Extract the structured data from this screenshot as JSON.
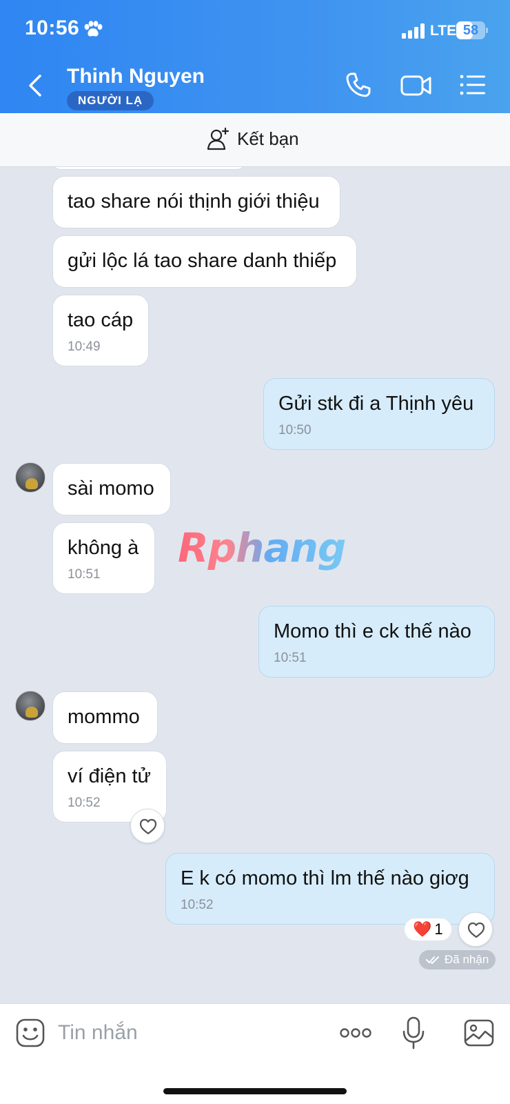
{
  "status_bar": {
    "time": "10:56",
    "network": "LTE",
    "battery": "58",
    "battery_fraction": 0.58
  },
  "header": {
    "contact_name": "Thinh Nguyen",
    "badge": "NGƯỜI LẠ",
    "icons": [
      "back-arrow-icon",
      "phone-icon",
      "video-call-icon",
      "menu-list-icon"
    ]
  },
  "add_friend": {
    "label": "Kết bạn"
  },
  "messages": [
    {
      "side": "in",
      "text": "tao share nói thịnh giới thiệu"
    },
    {
      "side": "in",
      "text": "gửi lộc lá tao share danh thiếp"
    },
    {
      "side": "in",
      "text": "tao cáp",
      "time": "10:49"
    },
    {
      "side": "out",
      "text": "Gửi stk đi a Thịnh yêu",
      "time": "10:50"
    },
    {
      "side": "in",
      "text": "sài momo"
    },
    {
      "side": "in",
      "text": "không à",
      "time": "10:51"
    },
    {
      "side": "out",
      "text": "Momo thì e ck thế nào",
      "time": "10:51"
    },
    {
      "side": "in",
      "text": "mommo"
    },
    {
      "side": "in",
      "text": "ví điện tử",
      "time": "10:52"
    },
    {
      "side": "out",
      "text": "E k có momo thì lm thế nào giơg",
      "time": "10:52"
    }
  ],
  "reaction": {
    "emoji": "❤️",
    "count": "1"
  },
  "delivery_status": "Đã nhận",
  "watermark": "Rphang",
  "composer": {
    "placeholder": "Tin nhắn",
    "icons": [
      "emoji-icon",
      "more-icon",
      "microphone-icon",
      "image-icon"
    ]
  }
}
